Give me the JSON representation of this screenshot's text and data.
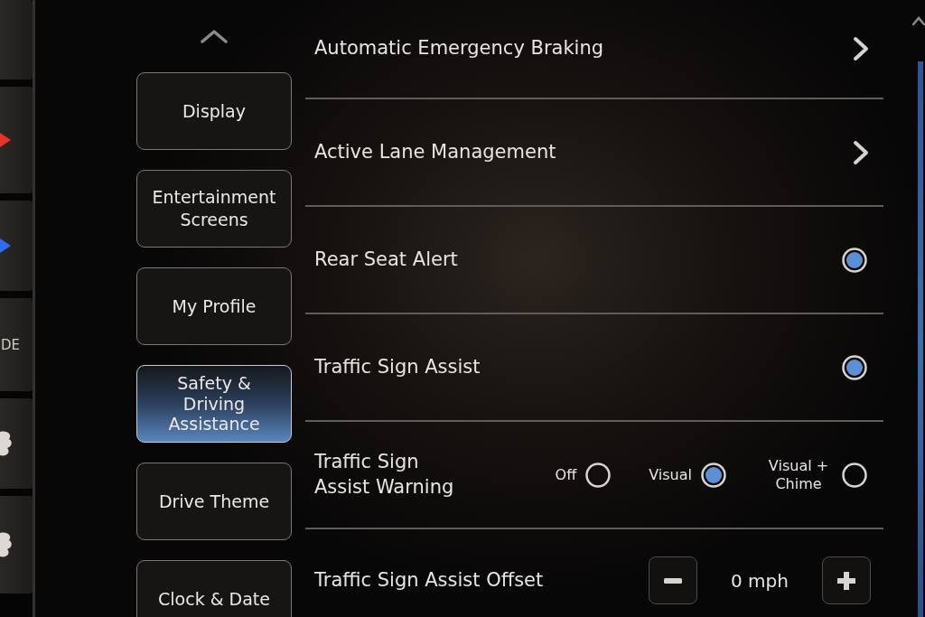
{
  "side_controls": [
    {
      "kind": "blank"
    },
    {
      "kind": "arrow",
      "color": "#e8322a"
    },
    {
      "kind": "arrow",
      "color": "#2f6df0"
    },
    {
      "kind": "label",
      "label": "DE"
    },
    {
      "kind": "fan"
    },
    {
      "kind": "fan"
    }
  ],
  "sidebar": {
    "items": [
      {
        "label": "Display",
        "selected": false
      },
      {
        "label": "Entertainment Screens",
        "selected": false
      },
      {
        "label": "My Profile",
        "selected": false
      },
      {
        "label": "Safety & Driving Assistance",
        "selected": true
      },
      {
        "label": "Drive Theme",
        "selected": false
      },
      {
        "label": "Clock & Date",
        "selected": false
      }
    ]
  },
  "settings": [
    {
      "kind": "link",
      "label": "Automatic Emergency Braking"
    },
    {
      "kind": "link",
      "label": "Active Lane Management"
    },
    {
      "kind": "toggle",
      "label": "Rear Seat Alert",
      "on": true
    },
    {
      "kind": "toggle",
      "label": "Traffic Sign Assist",
      "on": true
    },
    {
      "kind": "choice",
      "label": "Traffic Sign Assist Warning",
      "options": [
        {
          "label": "Off",
          "selected": false
        },
        {
          "label": "Visual",
          "selected": true
        },
        {
          "label": "Visual + Chime",
          "selected": false
        }
      ]
    },
    {
      "kind": "stepper",
      "label": "Traffic Sign Assist Offset",
      "value": "0 mph"
    }
  ]
}
